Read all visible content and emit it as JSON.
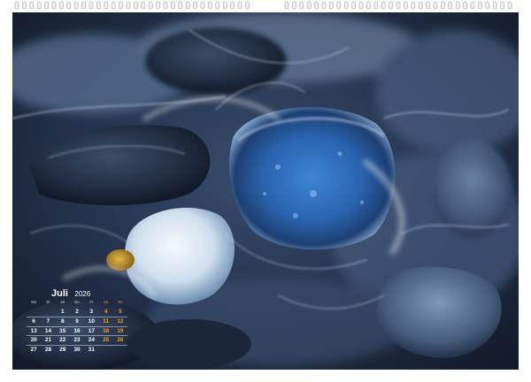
{
  "calendar": {
    "month": "Juli",
    "year": "2026",
    "weekday_headers": [
      "Mo",
      "Di",
      "Mi",
      "Do",
      "Fr",
      "Sa",
      "So"
    ],
    "weekend_color": "#f39a2c",
    "weeks": [
      [
        "",
        "",
        "1",
        "2",
        "3",
        "4",
        "5"
      ],
      [
        "6",
        "7",
        "8",
        "9",
        "10",
        "11",
        "12"
      ],
      [
        "13",
        "14",
        "15",
        "16",
        "17",
        "18",
        "19"
      ],
      [
        "20",
        "21",
        "22",
        "23",
        "24",
        "25",
        "26"
      ],
      [
        "27",
        "28",
        "29",
        "30",
        "31",
        "",
        ""
      ]
    ]
  },
  "photo": {
    "subject": "long-exposure-pebbles-in-surf",
    "colors": {
      "deep": "#16202f",
      "blue_stone": "#2f6bb8",
      "white_stone": "#e4eef6",
      "amber_pebble": "#c89a2c"
    }
  },
  "binding": {
    "hole_icon": "hanger-notch-icon",
    "wire_icon": "wire-o-binding-icon"
  }
}
